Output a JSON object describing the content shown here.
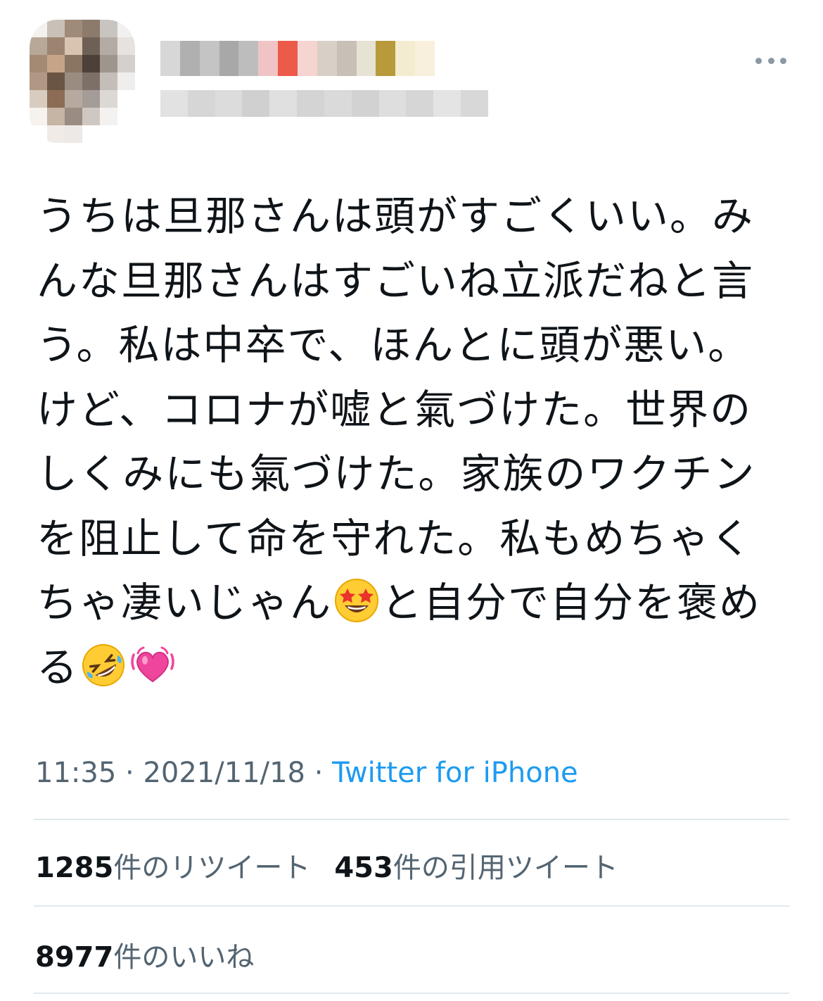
{
  "tweet": {
    "text_before_star": "うちは旦那さんは頭がすごくいい。みんな旦那さんはすごいね立派だねと言う。私は中卒で、ほんとに頭が悪い。けど、コロナが嘘と氣づけた。世界のしくみにも氣づけた。家族のワクチンを阻止して命を守れた。私もめちゃくちゃ凄いじゃん",
    "text_after_star": "と自分で自分を褒める",
    "emoji_star": "star-struck-face",
    "emoji_laugh": "rolling-on-floor-laughing-face",
    "emoji_heart": "beating-heart"
  },
  "meta": {
    "time": "11:35",
    "sep1": " · ",
    "date": "2021/11/18",
    "sep2": " · ",
    "source": "Twitter for iPhone"
  },
  "stats": {
    "retweets_count": "1285",
    "retweets_label": "件のリツイート",
    "quotes_count": "453",
    "quotes_label": "件の引用ツイート",
    "likes_count": "8977",
    "likes_label": "件のいいね"
  },
  "colors": {
    "text": "#0f1419",
    "secondary": "#536471",
    "link": "#1d9bf0",
    "divider": "#e1e8ed"
  }
}
